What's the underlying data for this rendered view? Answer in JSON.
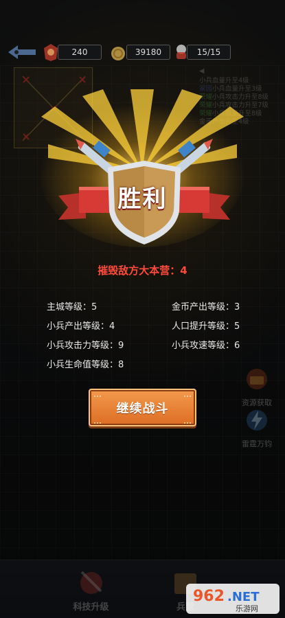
{
  "topbar": {
    "troops_value": "240",
    "gold_value": "39180",
    "population_value": "15/15"
  },
  "event_log": [
    {
      "text": "小兵血量升至4级",
      "tag": ""
    },
    {
      "text": "小兵血量升至3级",
      "tag": "家园"
    },
    {
      "text": "小兵攻击力升至8级",
      "tag": "荣耀"
    },
    {
      "text": "小兵攻击力升至7级",
      "tag": "荣耀"
    },
    {
      "text": "小兵血量升至8级",
      "tag": "荣耀"
    },
    {
      "text": "金币产出升至4级",
      "tag": ""
    }
  ],
  "victory": {
    "title": "胜利",
    "destroy_label": "摧毁敌方大本营：4"
  },
  "stats": [
    {
      "label": "主城等级：5",
      "side": "left"
    },
    {
      "label": "金币产出等级：3",
      "side": "right"
    },
    {
      "label": "小兵产出等级：4",
      "side": "left"
    },
    {
      "label": "人口提升等级：5",
      "side": "right"
    },
    {
      "label": "小兵攻击力等级：9",
      "side": "left"
    },
    {
      "label": "小兵攻速等级：6",
      "side": "right"
    },
    {
      "label": "小兵生命值等级：8",
      "side": "left"
    }
  ],
  "continue_button": {
    "label": "继续战斗"
  },
  "side_buttons": {
    "resource": "资源获取",
    "thunder": "雷霆万钧"
  },
  "bottom_bar": {
    "tech": "科技升级",
    "barracks": "兵营"
  },
  "watermark": {
    "brand": "962.NET",
    "sub": "乐游网"
  },
  "colors": {
    "accent_red": "#ff4a3a",
    "button_orange": "#e8813a",
    "ribbon_red": "#d73a34",
    "shield_gold": "#c9a15a"
  }
}
